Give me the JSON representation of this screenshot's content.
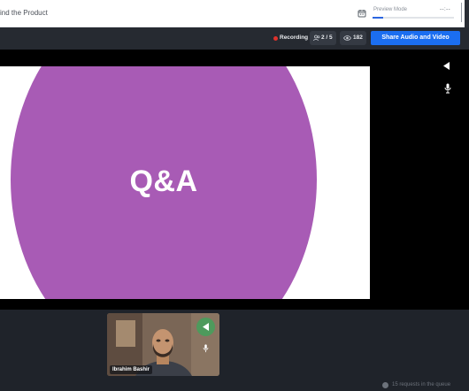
{
  "header": {
    "title": "ind the Product",
    "preview_label": "Preview Mode",
    "preview_time": "--:--",
    "preview_progress": 0.13
  },
  "toolbar": {
    "recording_label": "Recording",
    "participants_count": "2 / 5",
    "viewers_count": "182",
    "share_label": "Share Audio and Video"
  },
  "slide": {
    "text": "Q&A",
    "circle_color": "#a85bb5"
  },
  "participant": {
    "name": "Ibrahim Bashir"
  },
  "footer": {
    "queue_text": "15 requests in the queue"
  },
  "icons": [
    "calendar-icon",
    "users-icon",
    "eye-icon",
    "speaker-icon",
    "microphone-icon",
    "info-icon"
  ],
  "colors": {
    "accent": "#1b6ef0",
    "recording": "#e0322c",
    "speaker_active": "#4e9a5c"
  }
}
